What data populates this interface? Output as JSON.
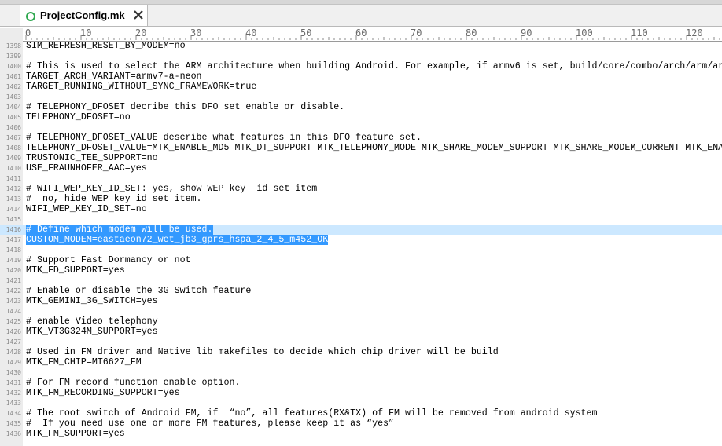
{
  "tab": {
    "filename": "ProjectConfig.mk",
    "status_icon": "saved-indicator-icon",
    "close_icon": "close-icon",
    "status_color": "#2fa84f"
  },
  "ruler": {
    "labels": [
      "0",
      "10",
      "20",
      "30",
      "40",
      "50",
      "60",
      "70",
      "80",
      "90",
      "100",
      "110",
      "120"
    ]
  },
  "selection_color": "#3399ff",
  "lines": [
    {
      "n": "1398",
      "text": "SIM_REFRESH_RESET_BY_MODEM=no"
    },
    {
      "n": "1399",
      "text": ""
    },
    {
      "n": "1400",
      "text": "# This is used to select the ARM architecture when building Android. For example, if armv6 is set, build/core/combo/arch/arm/ar"
    },
    {
      "n": "1401",
      "text": "TARGET_ARCH_VARIANT=armv7-a-neon"
    },
    {
      "n": "1402",
      "text": "TARGET_RUNNING_WITHOUT_SYNC_FRAMEWORK=true"
    },
    {
      "n": "1403",
      "text": ""
    },
    {
      "n": "1404",
      "text": "# TELEPHONY_DFOSET decribe this DFO set enable or disable."
    },
    {
      "n": "1405",
      "text": "TELEPHONY_DFOSET=no"
    },
    {
      "n": "1406",
      "text": ""
    },
    {
      "n": "1407",
      "text": "# TELEPHONY_DFOSET_VALUE describe what features in this DFO feature set."
    },
    {
      "n": "1408",
      "text": "TELEPHONY_DFOSET_VALUE=MTK_ENABLE_MD5 MTK_DT_SUPPORT MTK_TELEPHONY_MODE MTK_SHARE_MODEM_SUPPORT MTK_SHARE_MODEM_CURRENT MTK_ENA"
    },
    {
      "n": "1409",
      "text": "TRUSTONIC_TEE_SUPPORT=no"
    },
    {
      "n": "1410",
      "text": "USE_FRAUNHOFER_AAC=yes"
    },
    {
      "n": "1411",
      "text": ""
    },
    {
      "n": "1412",
      "text": "# WIFI_WEP_KEY_ID_SET: yes, show WEP key  id set item"
    },
    {
      "n": "1413",
      "text": "#  no, hide WEP key id set item."
    },
    {
      "n": "1414",
      "text": "WIFI_WEP_KEY_ID_SET=no"
    },
    {
      "n": "1415",
      "text": ""
    },
    {
      "n": "1416",
      "text": "# Define which modem will be used.",
      "selected": true,
      "full": true
    },
    {
      "n": "1417",
      "text": "CUSTOM_MODEM=eastaeon72_wet_jb3_gprs_hspa_2_4_5_m452_OK",
      "selected": true,
      "full": false
    },
    {
      "n": "1418",
      "text": ""
    },
    {
      "n": "1419",
      "text": "# Support Fast Dormancy or not"
    },
    {
      "n": "1420",
      "text": "MTK_FD_SUPPORT=yes"
    },
    {
      "n": "1421",
      "text": ""
    },
    {
      "n": "1422",
      "text": "# Enable or disable the 3G Switch feature"
    },
    {
      "n": "1423",
      "text": "MTK_GEMINI_3G_SWITCH=yes"
    },
    {
      "n": "1424",
      "text": ""
    },
    {
      "n": "1425",
      "text": "# enable Video telephony"
    },
    {
      "n": "1426",
      "text": "MTK_VT3G324M_SUPPORT=yes"
    },
    {
      "n": "1427",
      "text": ""
    },
    {
      "n": "1428",
      "text": "# Used in FM driver and Native lib makefiles to decide which chip driver will be build"
    },
    {
      "n": "1429",
      "text": "MTK_FM_CHIP=MT6627_FM"
    },
    {
      "n": "1430",
      "text": ""
    },
    {
      "n": "1431",
      "text": "# For FM record function enable option."
    },
    {
      "n": "1432",
      "text": "MTK_FM_RECORDING_SUPPORT=yes"
    },
    {
      "n": "1433",
      "text": ""
    },
    {
      "n": "1434",
      "text": "# The root switch of Android FM, if  “no”, all features(RX&TX) of FM will be removed from android system"
    },
    {
      "n": "1435",
      "text": "#  If you need use one or more FM features, please keep it as “yes”"
    },
    {
      "n": "1436",
      "text": "MTK_FM_SUPPORT=yes"
    }
  ]
}
